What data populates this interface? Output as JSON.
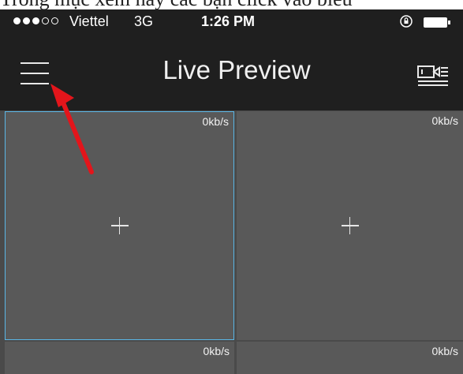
{
  "caption": "Trong mục xem này các bạn click vào biểu",
  "status_bar": {
    "signal_bars_filled": 3,
    "signal_bars_total": 5,
    "carrier": "Viettel",
    "network": "3G",
    "time": "1:26 PM",
    "icons": [
      "orientation-lock-icon",
      "battery-icon"
    ]
  },
  "nav": {
    "title": "Live Preview",
    "left_icon": "hamburger-menu-icon",
    "right_icon": "playback-camera-icon"
  },
  "tiles": [
    {
      "speed": "0kb/s",
      "selected": true
    },
    {
      "speed": "0kb/s",
      "selected": false
    },
    {
      "speed": "0kb/s",
      "selected": false
    },
    {
      "speed": "0kb/s",
      "selected": false
    }
  ],
  "annotation": {
    "type": "arrow",
    "color": "#e3151b",
    "points_to": "menu-button"
  },
  "colors": {
    "nav_background": "#1f1f1f",
    "tile_background": "#595959",
    "selected_border": "#5ab6e6"
  }
}
